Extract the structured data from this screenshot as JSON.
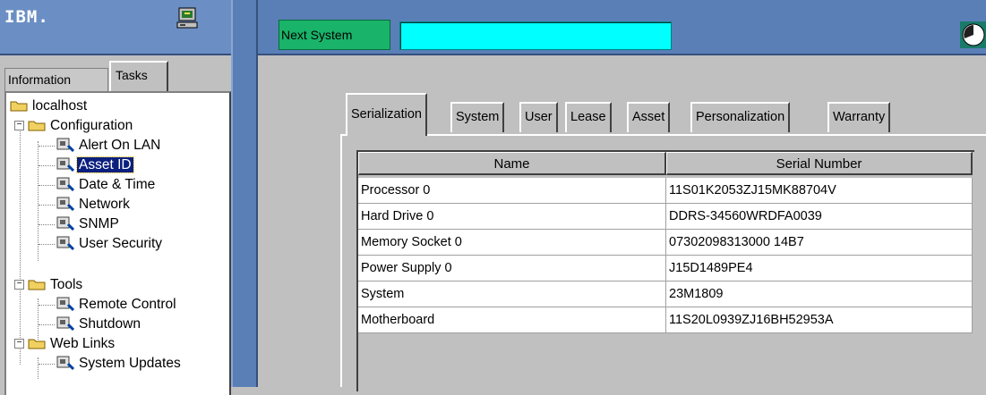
{
  "header": {
    "logo_text": "IBM.",
    "next_system_label": "Next System",
    "next_system_value": ""
  },
  "left_tabs": [
    "Information",
    "Tasks"
  ],
  "tree": {
    "root": "localhost",
    "groups": [
      {
        "label": "Configuration",
        "items": [
          "Alert On LAN",
          "Asset ID",
          "Date & Time",
          "Network",
          "SNMP",
          "User Security"
        ]
      },
      {
        "label": "Tools",
        "items": [
          "Remote Control",
          "Shutdown"
        ]
      },
      {
        "label": "Web Links",
        "items": [
          "System Updates"
        ]
      }
    ],
    "selected": "Asset ID"
  },
  "content_tabs": [
    "Serialization",
    "System",
    "User",
    "Lease",
    "Asset",
    "Personalization",
    "Warranty"
  ],
  "active_tab": "Serialization",
  "table": {
    "columns": [
      "Name",
      "Serial Number"
    ],
    "rows": [
      [
        "Processor 0",
        "11S01K2053ZJ15MK88704V"
      ],
      [
        "Hard Drive 0",
        "DDRS-34560WRDFA0039"
      ],
      [
        "Memory Socket 0",
        "07302098313000 14B7"
      ],
      [
        "Power Supply 0",
        "J15D1489PE4"
      ],
      [
        "System",
        "23M1809"
      ],
      [
        "Motherboard",
        "11S20L0939ZJ16BH52953A"
      ]
    ]
  },
  "colors": {
    "header_blue": "#5a7fb7",
    "next_system_green": "#19b36a",
    "next_system_field": "#00ffff",
    "selection": "#0a1f7e"
  }
}
